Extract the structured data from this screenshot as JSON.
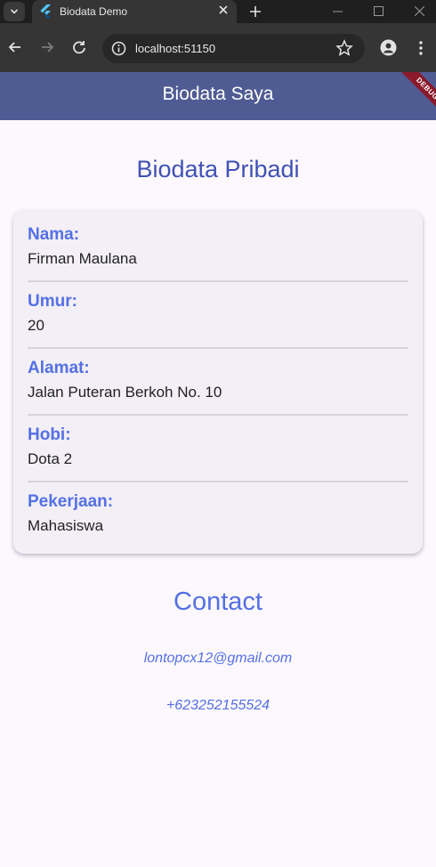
{
  "browser": {
    "tab_title": "Biodata Demo",
    "url": "localhost:51150",
    "icons": {
      "tab_search": "chevron-down-icon",
      "favicon": "flutter-logo",
      "tab_close": "close-icon",
      "new_tab": "plus-icon",
      "back": "arrow-left-icon",
      "forward": "arrow-right-icon",
      "reload": "reload-icon",
      "site_info": "info-icon",
      "bookmark": "star-icon",
      "profile": "account-icon",
      "menu": "kebab-menu-icon"
    }
  },
  "appbar": {
    "title": "Biodata Saya",
    "debug_banner": "DEBUG",
    "color": "#4f5b93"
  },
  "page": {
    "title": "Biodata Pribadi"
  },
  "biodata": [
    {
      "label": "Nama:",
      "value": "Firman Maulana"
    },
    {
      "label": "Umur:",
      "value": "20"
    },
    {
      "label": "Alamat:",
      "value": "Jalan Puteran Berkoh No. 10"
    },
    {
      "label": "Hobi:",
      "value": "Dota 2"
    },
    {
      "label": "Pekerjaan:",
      "value": "Mahasiswa"
    }
  ],
  "contact": {
    "title": "Contact",
    "email": "lontopcx12@gmail.com",
    "phone": "+623252155524"
  },
  "colors": {
    "accent": "#5470e6",
    "title": "#3f51b5",
    "background": "#fcf8fd",
    "card": "#f3eff6"
  }
}
